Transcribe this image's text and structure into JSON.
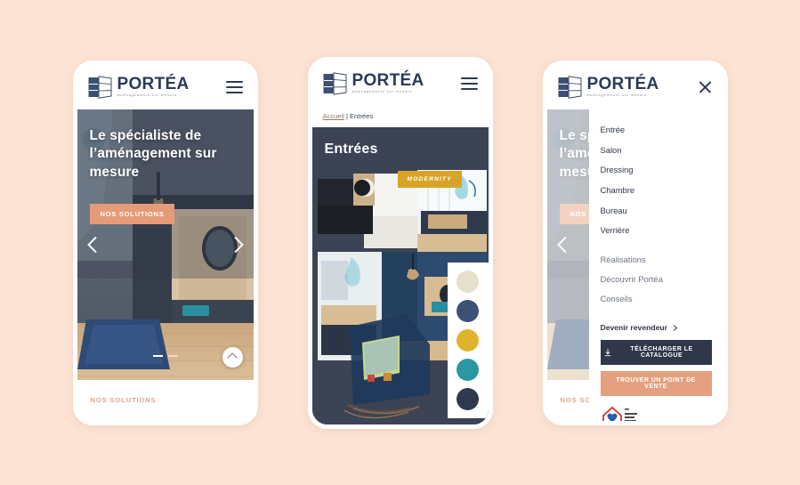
{
  "theme": {
    "page_background": "#fce3d4",
    "navy": "#2c3a56",
    "dark_navy": "#2f3749",
    "salmon": "#e4a07f",
    "gold": "#d7a427",
    "teal": "#2a97a3",
    "cream": "#e4ddcb"
  },
  "brand": {
    "name": "PORTÉA",
    "tagline": "aménagements sur mesure",
    "logo_icon": "portea-window-logo-icon"
  },
  "phone_home": {
    "menu_icon": "hamburger-menu-icon",
    "hero": {
      "heading": "Le spécialiste de l’aménagement sur mesure",
      "cta_label": "NOS SOLUTIONS",
      "prev_icon": "chevron-left-icon",
      "next_icon": "chevron-right-icon",
      "scroll_top_icon": "chevron-up-icon",
      "slide_count": 2,
      "active_slide": 1
    },
    "footer_label": "NOS SOLUTIONS"
  },
  "phone_category": {
    "menu_icon": "hamburger-menu-icon",
    "breadcrumb": {
      "home": "Accueil",
      "separator": "|",
      "current": "Entrées"
    },
    "title": "Entrées",
    "badge": "MODERNITY",
    "swatches": [
      {
        "name": "cream",
        "hex": "#e7e0cd"
      },
      {
        "name": "navy",
        "hex": "#3b5275"
      },
      {
        "name": "gold",
        "hex": "#e0b32c"
      },
      {
        "name": "teal",
        "hex": "#2a97a3"
      },
      {
        "name": "dark-navy",
        "hex": "#2f3b4d"
      }
    ]
  },
  "phone_menu": {
    "close_icon": "close-icon",
    "behind_heading": "Le spécialiste de l’aménagement sur mesure",
    "behind_cta": "NOS SOLUTIONS",
    "behind_footer": "NOS SOLUTIONS",
    "primary_items": [
      "Entrée",
      "Salon",
      "Dressing",
      "Chambre",
      "Bureau",
      "Verrière"
    ],
    "secondary_items": [
      "Réalisations",
      "Découvrir Portéa",
      "Conseils"
    ],
    "reseller_label": "Devenir revendeur",
    "reseller_icon": "chevron-right-icon",
    "catalogue_button": "TÉLÉCHARGER LE CATALOGUE",
    "catalogue_icon": "download-icon",
    "store_button": "TROUVER UN POINT DE VENTE",
    "made_in_france_icon": "made-in-france-badge-icon"
  }
}
